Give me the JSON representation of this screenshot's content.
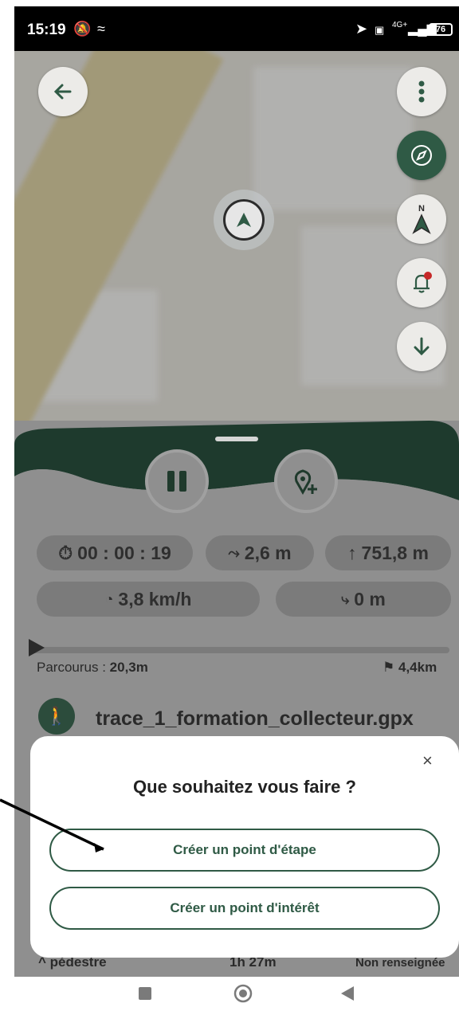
{
  "status_bar": {
    "time": "15:19",
    "battery": "76",
    "network": "4G+"
  },
  "map": {
    "buttons": [
      "back-arrow-icon",
      "more-vertical-icon",
      "compass-icon",
      "north-arrow-icon",
      "alert-bell-icon",
      "arrow-down-icon"
    ],
    "north_label": "N"
  },
  "stats": {
    "duration": "00 : 00 : 19",
    "elevation_gain_small": "2,6 m",
    "altitude": "751,8 m",
    "speed": "3,8 km/h",
    "descent": "0 m"
  },
  "progress": {
    "traveled_label": "Parcourus : ",
    "traveled_value": "20,3m",
    "total": "4,4km",
    "fraction": 0.005
  },
  "trace": {
    "name": "trace_1_formation_collecteur.gpx"
  },
  "info_row": {
    "mode": "pédestre",
    "duration": "1h 27m",
    "difficulty": "Non renseignée"
  },
  "dialog": {
    "title": "Que souhaitez vous faire ?",
    "close": "×",
    "button_waypoint": "Créer un point d'étape",
    "button_poi": "Créer un point d'intérêt"
  },
  "colors": {
    "primary_green": "#2f5a45",
    "dark_green": "#2c4c3c"
  }
}
